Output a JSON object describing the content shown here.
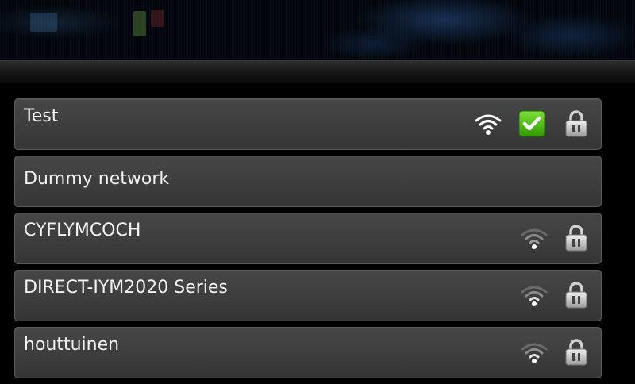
{
  "networks": [
    {
      "ssid": "Test",
      "signal": "strong",
      "connected": true,
      "secured": true
    },
    {
      "ssid": "Dummy network",
      "signal": "none",
      "connected": false,
      "secured": false
    },
    {
      "ssid": "CYFLYMCOCH",
      "signal": "weak",
      "connected": false,
      "secured": true
    },
    {
      "ssid": "DIRECT-IYM2020 Series",
      "signal": "weak",
      "connected": false,
      "secured": true
    },
    {
      "ssid": "houttuinen",
      "signal": "weak",
      "connected": false,
      "secured": true
    }
  ],
  "icons": {
    "wifi": "wifi-signal-icon",
    "check": "connected-check-icon",
    "lock": "padlock-icon"
  },
  "colors": {
    "row_bg": "#3e3e3e",
    "check_green": "#38b000",
    "wifi_strong": "#ffffff",
    "wifi_weak": "#9a9a9a",
    "text": "#f2f2f2"
  }
}
